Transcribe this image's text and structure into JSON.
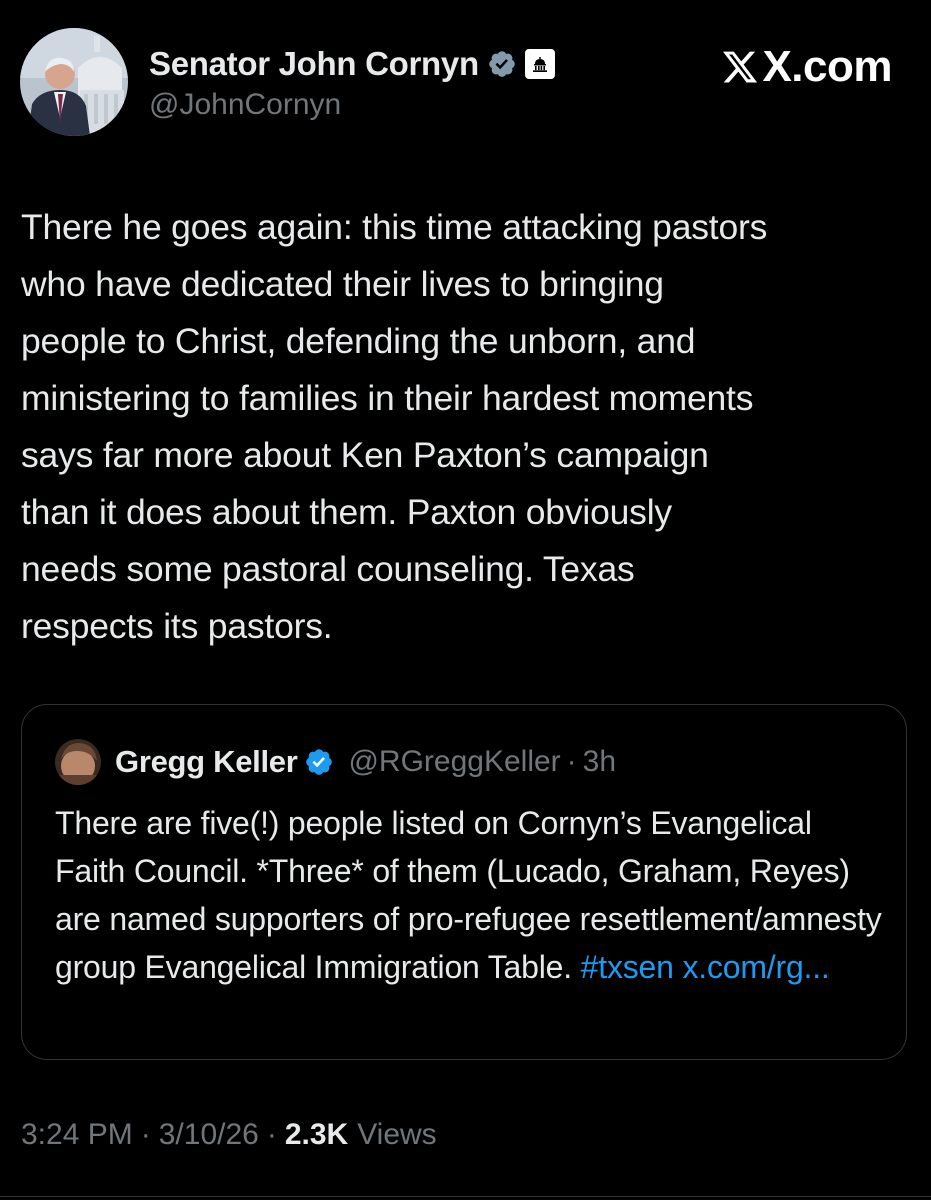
{
  "colors": {
    "background": "#000000",
    "text_primary": "#e7e9ea",
    "text_secondary": "#71767b",
    "link": "#1d9bf0",
    "verified_badge": "#829aab",
    "border": "#2f3336"
  },
  "header": {
    "display_name": "Senator John Cornyn",
    "handle": "@JohnCornyn",
    "verified_icon": "verified-badge-icon",
    "affiliation_icon": "government-building-icon",
    "site_label": "X.com",
    "site_icon": "x-logo-icon"
  },
  "tweet": {
    "text": "There he goes again: this time attacking pastors\nwho have dedicated their lives to bringing\npeople to Christ, defending the unborn, and\nministering to families in their hardest moments\nsays far more about Ken Paxton’s campaign\nthan it does about them. Paxton obviously\nneeds some pastoral counseling. Texas\nrespects its pastors."
  },
  "quoted_tweet": {
    "display_name": "Gregg Keller",
    "handle": "@RGreggKeller",
    "separator": "·",
    "time": "3h",
    "verified_icon": "verified-badge-icon",
    "text_before": "There are five(!) people listed on Cornyn’s Evangelical Faith Council. *Three* of them (Lucado, Graham, Reyes) are named supporters of pro-refugee resettlement/amnesty group Evangelical Immigration Table.",
    "hashtag": "#txsen",
    "link": "x.com/rg..."
  },
  "meta": {
    "time": "3:24 PM",
    "separator": "·",
    "date": "3/10/26",
    "views_count": "2.3K",
    "views_label": "Views"
  }
}
